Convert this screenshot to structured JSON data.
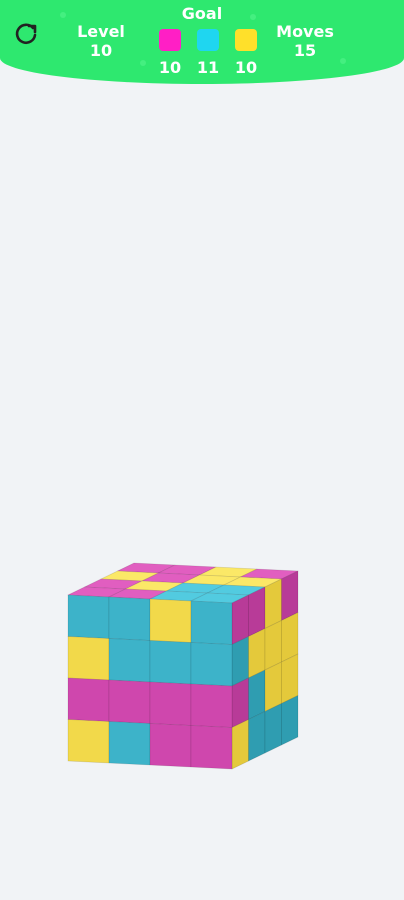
{
  "hud": {
    "level_label": "Level",
    "level_value": "10",
    "goal_label": "Goal",
    "moves_label": "Moves",
    "moves_value": "15",
    "restart_icon": "restart-icon",
    "goals": [
      {
        "color": "#ff1fc5",
        "count": "10"
      },
      {
        "color": "#1fd6f0",
        "count": "11"
      },
      {
        "color": "#ffe02a",
        "count": "10"
      }
    ]
  },
  "colors": {
    "hud_green": "#2ee86f",
    "background": "#f1f3f6",
    "M": [
      "#e15ec0",
      "#cf47ad",
      "#b83b98"
    ],
    "C": [
      "#52cbe0",
      "#3db3c9",
      "#2f9db1"
    ],
    "Y": [
      "#fbe867",
      "#f2d94a",
      "#e4c93b"
    ]
  },
  "cube": {
    "front": [
      [
        "C",
        "C",
        "Y",
        "C"
      ],
      [
        "Y",
        "C",
        "C",
        "C"
      ],
      [
        "M",
        "M",
        "M",
        "M"
      ],
      [
        "Y",
        "C",
        "M",
        "M"
      ]
    ],
    "top": [
      [
        "M",
        "M",
        "Y",
        "M"
      ],
      [
        "Y",
        "M",
        "Y",
        "Y"
      ],
      [
        "M",
        "Y",
        "C",
        "C"
      ],
      [
        "M",
        "M",
        "C",
        "C"
      ]
    ],
    "right": [
      [
        "M",
        "M",
        "Y",
        "M"
      ],
      [
        "C",
        "Y",
        "Y",
        "Y"
      ],
      [
        "M",
        "C",
        "Y",
        "Y"
      ],
      [
        "Y",
        "C",
        "C",
        "C"
      ]
    ]
  }
}
